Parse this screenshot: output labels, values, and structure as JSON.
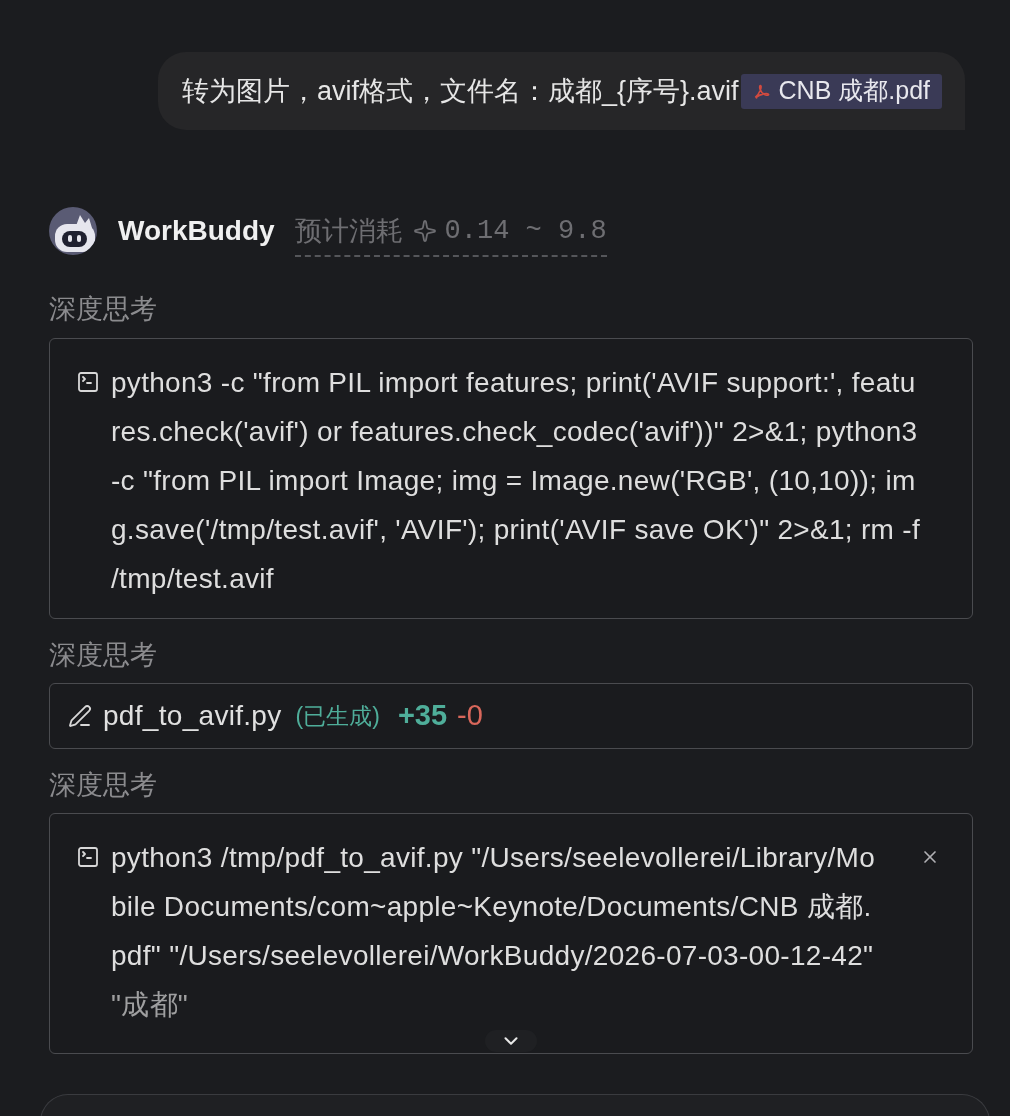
{
  "user_message": {
    "text": "转为图片，avif格式，文件名：成都_{序号}.avif",
    "attachment": {
      "name": "CNB 成都.pdf"
    }
  },
  "assistant": {
    "name": "WorkBuddy",
    "cost": {
      "label": "预计消耗",
      "range": "0.14 ~ 9.8"
    }
  },
  "steps": [
    {
      "kind": "thinking",
      "label": "深度思考"
    },
    {
      "kind": "command",
      "text": "python3 -c \"from PIL import features; print('AVIF support:', features.check('avif') or features.check_codec('avif'))\" 2>&1; python3 -c \"from PIL import Image; img = Image.new('RGB', (10,10)); img.save('/tmp/test.avif', 'AVIF'); print('AVIF save OK')\" 2>&1; rm -f /tmp/test.avif",
      "running": false,
      "truncated": false
    },
    {
      "kind": "thinking",
      "label": "深度思考"
    },
    {
      "kind": "file",
      "filename": "pdf_to_avif.py",
      "status": "(已生成)",
      "added": "+35",
      "removed": "-0"
    },
    {
      "kind": "thinking",
      "label": "深度思考"
    },
    {
      "kind": "command",
      "text": "python3 /tmp/pdf_to_avif.py \"/Users/seelevollerei/Library/Mobile Documents/com~apple~Keynote/Documents/CNB 成都.pdf\" \"/Users/seelevollerei/WorkBuddy/2026-07-03-00-12-42\" \"成都\"",
      "running": true,
      "truncated": true
    }
  ]
}
